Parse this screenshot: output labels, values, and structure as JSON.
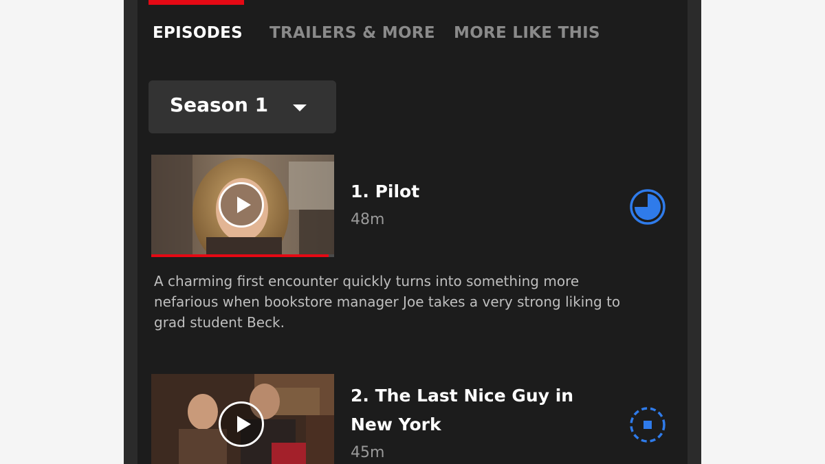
{
  "tabs": [
    {
      "label": "EPISODES",
      "active": true
    },
    {
      "label": "TRAILERS & MORE",
      "active": false
    },
    {
      "label": "MORE LIKE THIS",
      "active": false
    }
  ],
  "season_selector": {
    "selected": "Season 1"
  },
  "episodes": [
    {
      "title": "1. Pilot",
      "duration": "48m",
      "description": "A charming first encounter quickly turns into something more nefarious when bookstore manager Joe takes a very strong liking to grad student Beck.",
      "watch_progress": 0.97,
      "download_state": "download-progress-icon"
    },
    {
      "title": "2. The Last Nice Guy in New York",
      "duration": "45m",
      "download_state": "download-queued-icon"
    }
  ],
  "colors": {
    "accent_red": "#e50914",
    "download_blue": "#2f7bea",
    "background": "#1c1c1c"
  }
}
